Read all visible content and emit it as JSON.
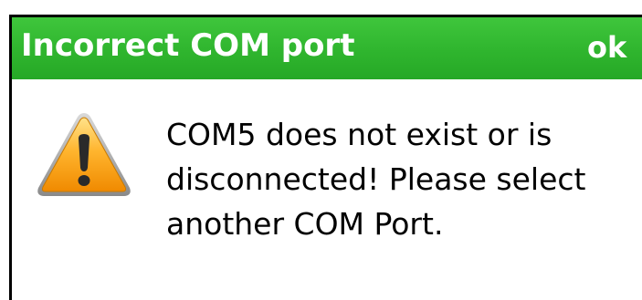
{
  "dialog": {
    "title": "Incorrect COM port",
    "ok_label": "ok",
    "message": "COM5 does not exist or is disconnected! Please select another COM Port.",
    "icon": "warning-icon"
  },
  "colors": {
    "titlebar": "#2fb52e",
    "title_text": "#ffffff",
    "border": "#000000",
    "warning_fill": "#f5a623",
    "warning_stroke": "#b36b00"
  }
}
